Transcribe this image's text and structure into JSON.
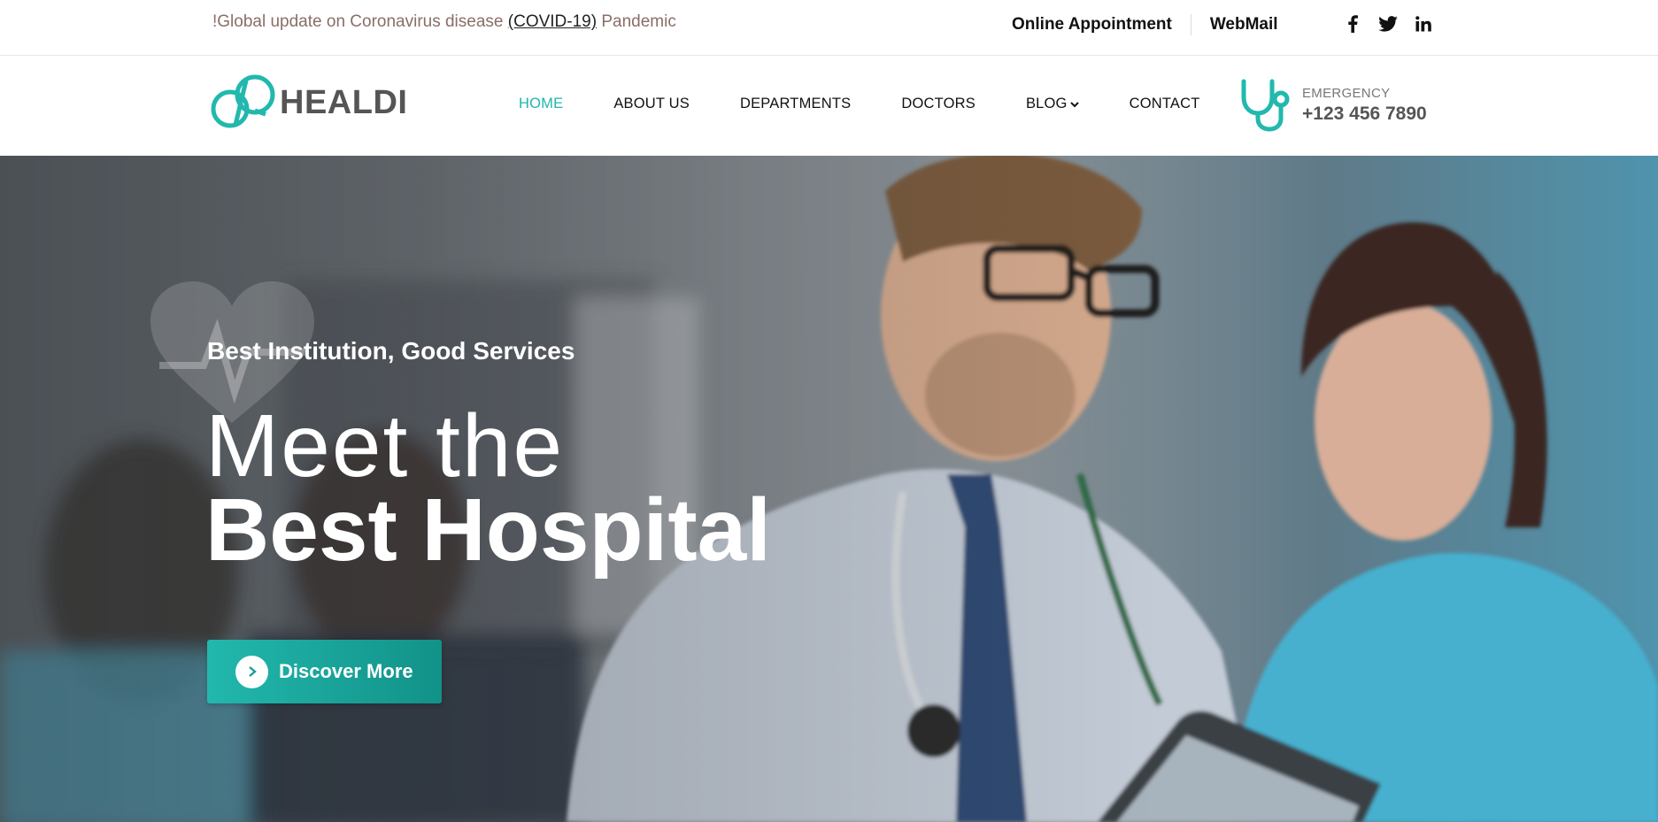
{
  "topbar": {
    "notice_prefix": "!Global update on Coronavirus disease ",
    "notice_link": "(COVID-19)",
    "notice_suffix": " Pandemic",
    "online_appointment": "Online Appointment",
    "webmail": "WebMail",
    "social": [
      "facebook-icon",
      "twitter-icon",
      "linkedin-icon"
    ]
  },
  "header": {
    "brand": "HEALDI",
    "nav": [
      {
        "label": "HOME",
        "active": true
      },
      {
        "label": "ABOUT US"
      },
      {
        "label": "DEPARTMENTS"
      },
      {
        "label": "DOCTORS"
      },
      {
        "label": "BLOG",
        "has_dropdown": true
      },
      {
        "label": "CONTACT"
      }
    ],
    "emergency_label": "EMERGENCY",
    "emergency_phone": "+123 456 7890"
  },
  "hero": {
    "eyebrow": "Best Institution, Good Services",
    "title_line1": "Meet the",
    "title_line2": "Best Hospital",
    "cta_label": "Discover More"
  },
  "colors": {
    "accent": "#1fb4ad",
    "notice_text": "#8a6e67",
    "brand_text": "#555555"
  }
}
